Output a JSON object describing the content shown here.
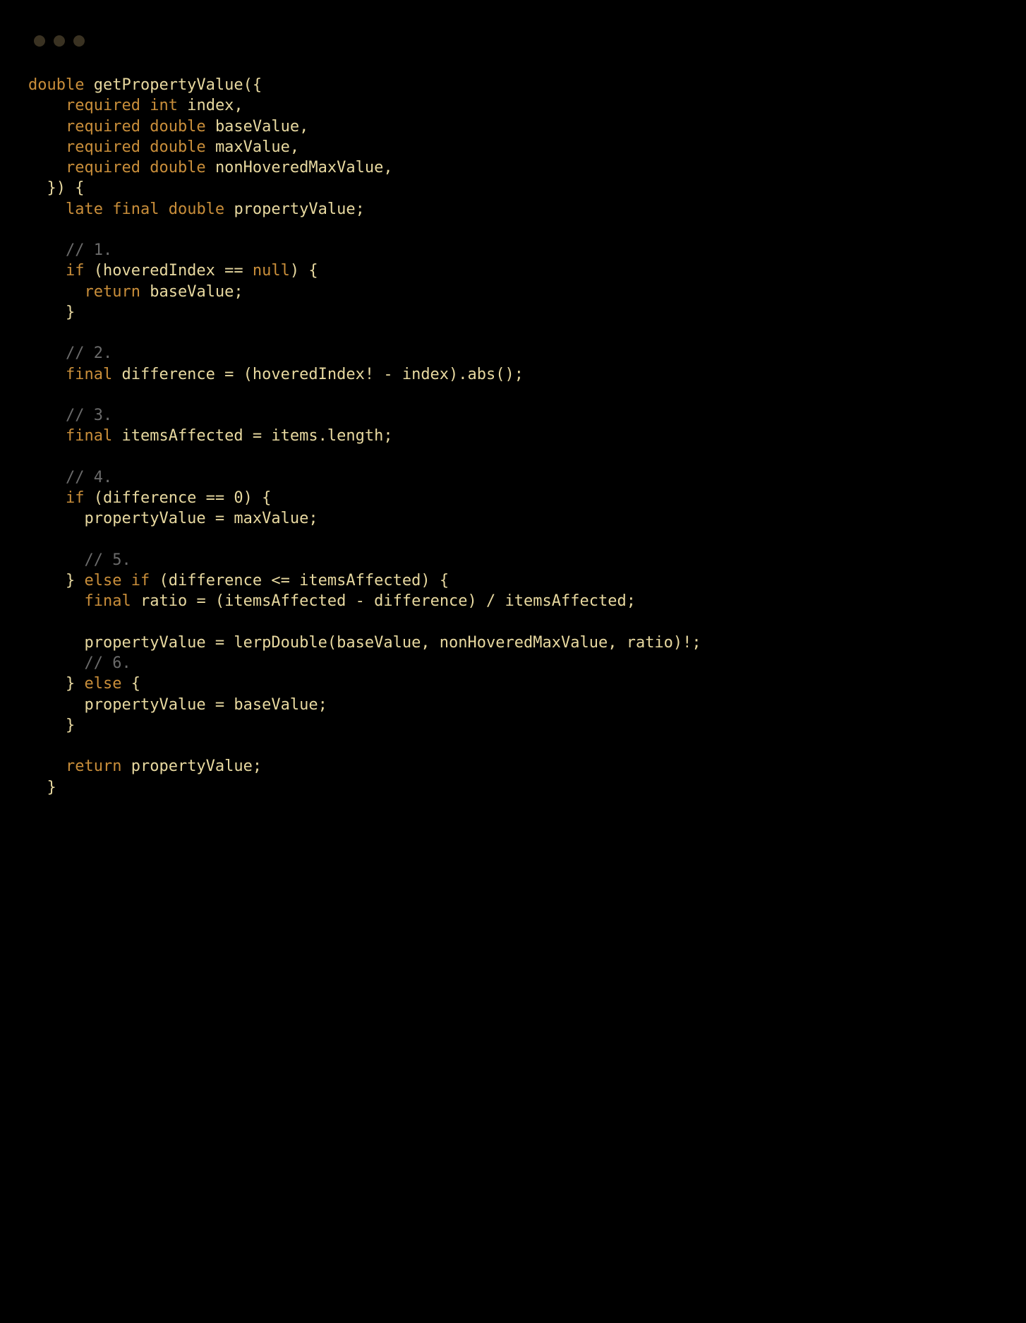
{
  "colors": {
    "background": "#000000",
    "text_default": "#e8d9a0",
    "keyword": "#c98e3a",
    "comment": "#6b6b6b",
    "traffic_light": "#3a3222"
  },
  "window": {
    "kind": "code-snippet",
    "language": "dart"
  },
  "code": {
    "tokens": [
      {
        "t": "kw",
        "v": "double"
      },
      {
        "t": "sp"
      },
      {
        "t": "fn",
        "v": "getPropertyValue"
      },
      {
        "t": "id",
        "v": "({"
      },
      {
        "t": "nl"
      },
      {
        "t": "indent",
        "n": 2
      },
      {
        "t": "kw",
        "v": "required"
      },
      {
        "t": "sp"
      },
      {
        "t": "kw",
        "v": "int"
      },
      {
        "t": "sp"
      },
      {
        "t": "id",
        "v": "index,"
      },
      {
        "t": "nl"
      },
      {
        "t": "indent",
        "n": 2
      },
      {
        "t": "kw",
        "v": "required"
      },
      {
        "t": "sp"
      },
      {
        "t": "kw",
        "v": "double"
      },
      {
        "t": "sp"
      },
      {
        "t": "id",
        "v": "baseValue,"
      },
      {
        "t": "nl"
      },
      {
        "t": "indent",
        "n": 2
      },
      {
        "t": "kw",
        "v": "required"
      },
      {
        "t": "sp"
      },
      {
        "t": "kw",
        "v": "double"
      },
      {
        "t": "sp"
      },
      {
        "t": "id",
        "v": "maxValue,"
      },
      {
        "t": "nl"
      },
      {
        "t": "indent",
        "n": 2
      },
      {
        "t": "kw",
        "v": "required"
      },
      {
        "t": "sp"
      },
      {
        "t": "kw",
        "v": "double"
      },
      {
        "t": "sp"
      },
      {
        "t": "id",
        "v": "nonHoveredMaxValue,"
      },
      {
        "t": "nl"
      },
      {
        "t": "indent",
        "n": 1
      },
      {
        "t": "id",
        "v": "}) {"
      },
      {
        "t": "nl"
      },
      {
        "t": "indent",
        "n": 2
      },
      {
        "t": "kw",
        "v": "late"
      },
      {
        "t": "sp"
      },
      {
        "t": "kw",
        "v": "final"
      },
      {
        "t": "sp"
      },
      {
        "t": "kw",
        "v": "double"
      },
      {
        "t": "sp"
      },
      {
        "t": "id",
        "v": "propertyValue;"
      },
      {
        "t": "nl"
      },
      {
        "t": "nl"
      },
      {
        "t": "indent",
        "n": 2
      },
      {
        "t": "cmt",
        "v": "// 1."
      },
      {
        "t": "nl"
      },
      {
        "t": "indent",
        "n": 2
      },
      {
        "t": "kw",
        "v": "if"
      },
      {
        "t": "sp"
      },
      {
        "t": "id",
        "v": "(hoveredIndex == "
      },
      {
        "t": "kw",
        "v": "null"
      },
      {
        "t": "id",
        "v": ") {"
      },
      {
        "t": "nl"
      },
      {
        "t": "indent",
        "n": 3
      },
      {
        "t": "kw",
        "v": "return"
      },
      {
        "t": "sp"
      },
      {
        "t": "id",
        "v": "baseValue;"
      },
      {
        "t": "nl"
      },
      {
        "t": "indent",
        "n": 2
      },
      {
        "t": "id",
        "v": "}"
      },
      {
        "t": "nl"
      },
      {
        "t": "nl"
      },
      {
        "t": "indent",
        "n": 2
      },
      {
        "t": "cmt",
        "v": "// 2."
      },
      {
        "t": "nl"
      },
      {
        "t": "indent",
        "n": 2
      },
      {
        "t": "kw",
        "v": "final"
      },
      {
        "t": "sp"
      },
      {
        "t": "id",
        "v": "difference = (hoveredIndex! - index).abs();"
      },
      {
        "t": "nl"
      },
      {
        "t": "nl"
      },
      {
        "t": "indent",
        "n": 2
      },
      {
        "t": "cmt",
        "v": "// 3."
      },
      {
        "t": "nl"
      },
      {
        "t": "indent",
        "n": 2
      },
      {
        "t": "kw",
        "v": "final"
      },
      {
        "t": "sp"
      },
      {
        "t": "id",
        "v": "itemsAffected = items.length;"
      },
      {
        "t": "nl"
      },
      {
        "t": "nl"
      },
      {
        "t": "indent",
        "n": 2
      },
      {
        "t": "cmt",
        "v": "// 4."
      },
      {
        "t": "nl"
      },
      {
        "t": "indent",
        "n": 2
      },
      {
        "t": "kw",
        "v": "if"
      },
      {
        "t": "sp"
      },
      {
        "t": "id",
        "v": "(difference == "
      },
      {
        "t": "num",
        "v": "0"
      },
      {
        "t": "id",
        "v": ") {"
      },
      {
        "t": "nl"
      },
      {
        "t": "indent",
        "n": 3
      },
      {
        "t": "id",
        "v": "propertyValue = maxValue;"
      },
      {
        "t": "nl"
      },
      {
        "t": "nl"
      },
      {
        "t": "indent",
        "n": 3
      },
      {
        "t": "cmt",
        "v": "// 5."
      },
      {
        "t": "nl"
      },
      {
        "t": "indent",
        "n": 2
      },
      {
        "t": "id",
        "v": "} "
      },
      {
        "t": "kw",
        "v": "else"
      },
      {
        "t": "sp"
      },
      {
        "t": "kw",
        "v": "if"
      },
      {
        "t": "sp"
      },
      {
        "t": "id",
        "v": "(difference <= itemsAffected) {"
      },
      {
        "t": "nl"
      },
      {
        "t": "indent",
        "n": 3
      },
      {
        "t": "kw",
        "v": "final"
      },
      {
        "t": "sp"
      },
      {
        "t": "id",
        "v": "ratio = (itemsAffected - difference) / itemsAffected;"
      },
      {
        "t": "nl"
      },
      {
        "t": "nl"
      },
      {
        "t": "indent",
        "n": 3
      },
      {
        "t": "id",
        "v": "propertyValue = lerpDouble(baseValue, nonHoveredMaxValue, ratio)!;"
      },
      {
        "t": "nl"
      },
      {
        "t": "indent",
        "n": 3
      },
      {
        "t": "cmt",
        "v": "// 6."
      },
      {
        "t": "nl"
      },
      {
        "t": "indent",
        "n": 2
      },
      {
        "t": "id",
        "v": "} "
      },
      {
        "t": "kw",
        "v": "else"
      },
      {
        "t": "sp"
      },
      {
        "t": "id",
        "v": "{"
      },
      {
        "t": "nl"
      },
      {
        "t": "indent",
        "n": 3
      },
      {
        "t": "id",
        "v": "propertyValue = baseValue;"
      },
      {
        "t": "nl"
      },
      {
        "t": "indent",
        "n": 2
      },
      {
        "t": "id",
        "v": "}"
      },
      {
        "t": "nl"
      },
      {
        "t": "nl"
      },
      {
        "t": "indent",
        "n": 2
      },
      {
        "t": "kw",
        "v": "return"
      },
      {
        "t": "sp"
      },
      {
        "t": "id",
        "v": "propertyValue;"
      },
      {
        "t": "nl"
      },
      {
        "t": "indent",
        "n": 1
      },
      {
        "t": "id",
        "v": "}"
      }
    ],
    "indent_unit": "  "
  }
}
